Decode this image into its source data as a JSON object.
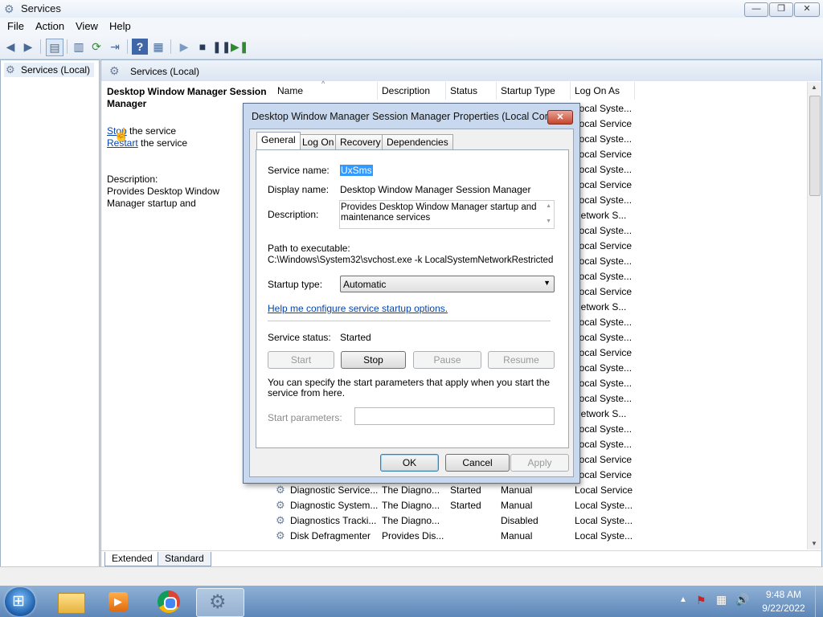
{
  "window": {
    "title": "Services",
    "min": "—",
    "max": "❐",
    "close": "✕"
  },
  "menu": [
    "File",
    "Action",
    "View",
    "Help"
  ],
  "tree": {
    "root": "Services (Local)"
  },
  "pane": {
    "header": "Services (Local)",
    "selected_title": "Desktop Window Manager Session Manager",
    "stop_link": "Stop",
    "stop_rest": " the service",
    "restart_link": "Restart",
    "restart_rest": " the service",
    "desc_label": "Description:",
    "desc_text": "Provides Desktop Window Manager startup and maintenance services"
  },
  "columns": [
    "Name",
    "Description",
    "Status",
    "Startup Type",
    "Log On As"
  ],
  "logon_visible": [
    "Local Syste...",
    "Local Service",
    "Local Syste...",
    "Local Service",
    "Local Syste...",
    "Local Service",
    "Local Syste...",
    "Network S...",
    "Local Syste...",
    "Local Service",
    "Local Syste...",
    "Local Syste...",
    "Local Service",
    "Network S...",
    "Local Syste...",
    "Local Syste...",
    "Local Service",
    "Local Syste...",
    "Local Syste...",
    "Local Syste...",
    "Network S...",
    "Local Syste...",
    "Local Syste...",
    "Local Service",
    "Local Service"
  ],
  "rows": [
    {
      "name": "Diagnostic Service...",
      "desc": "The Diagno...",
      "status": "Started",
      "startup": "Manual",
      "logon": "Local Service"
    },
    {
      "name": "Diagnostic System...",
      "desc": "The Diagno...",
      "status": "Started",
      "startup": "Manual",
      "logon": "Local Syste..."
    },
    {
      "name": "Diagnostics Tracki...",
      "desc": "The Diagno...",
      "status": "",
      "startup": "Disabled",
      "logon": "Local Syste..."
    },
    {
      "name": "Disk Defragmenter",
      "desc": "Provides Dis...",
      "status": "",
      "startup": "Manual",
      "logon": "Local Syste..."
    }
  ],
  "bottom_tabs": [
    "Extended",
    "Standard"
  ],
  "dialog": {
    "title": "Desktop Window Manager Session Manager Properties (Local Com...",
    "close": "✕",
    "tabs": [
      "General",
      "Log On",
      "Recovery",
      "Dependencies"
    ],
    "service_name_label": "Service name:",
    "service_name": "UxSms",
    "display_name_label": "Display name:",
    "display_name": "Desktop Window Manager Session Manager",
    "description_label": "Description:",
    "description": "Provides Desktop Window Manager startup and maintenance services",
    "path_label": "Path to executable:",
    "path": "C:\\Windows\\System32\\svchost.exe -k LocalSystemNetworkRestricted",
    "startup_label": "Startup type:",
    "startup_value": "Automatic",
    "help_link": "Help me configure service startup options.",
    "status_label": "Service status:",
    "status_value": "Started",
    "btn_start": "Start",
    "btn_stop": "Stop",
    "btn_pause": "Pause",
    "btn_resume": "Resume",
    "params_note": "You can specify the start parameters that apply when you start the service from here.",
    "params_label": "Start parameters:",
    "params_value": "",
    "ok": "OK",
    "cancel": "Cancel",
    "apply": "Apply"
  },
  "clock": {
    "time": "9:48 AM",
    "date": "9/22/2022"
  }
}
